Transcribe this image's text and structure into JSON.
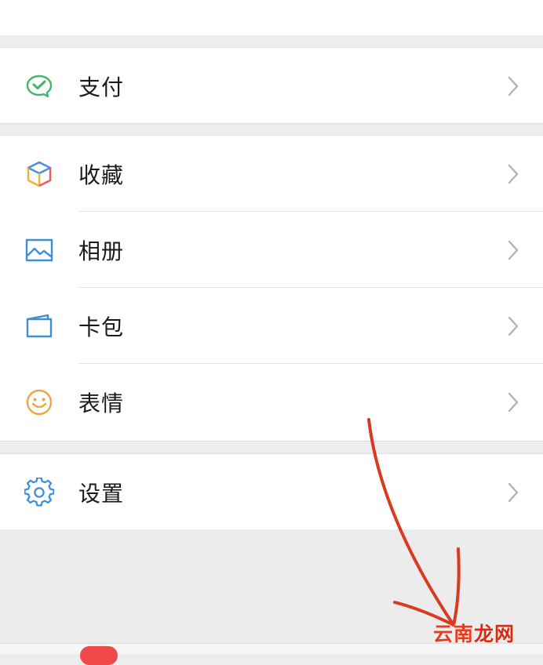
{
  "menu": {
    "pay": {
      "label": "支付",
      "icon": "wechat-pay-icon"
    },
    "favorites": {
      "label": "收藏",
      "icon": "favorites-cube-icon"
    },
    "album": {
      "label": "相册",
      "icon": "photo-album-icon"
    },
    "cards": {
      "label": "卡包",
      "icon": "card-wallet-icon"
    },
    "stickers": {
      "label": "表情",
      "icon": "smiley-icon"
    },
    "settings": {
      "label": "设置",
      "icon": "gear-icon"
    }
  },
  "watermark": {
    "text_a": "云南",
    "text_b": "龙网"
  },
  "colors": {
    "background": "#ededed",
    "row": "#ffffff",
    "annotation_arrow": "#d83a22",
    "badge": "#f04848"
  }
}
